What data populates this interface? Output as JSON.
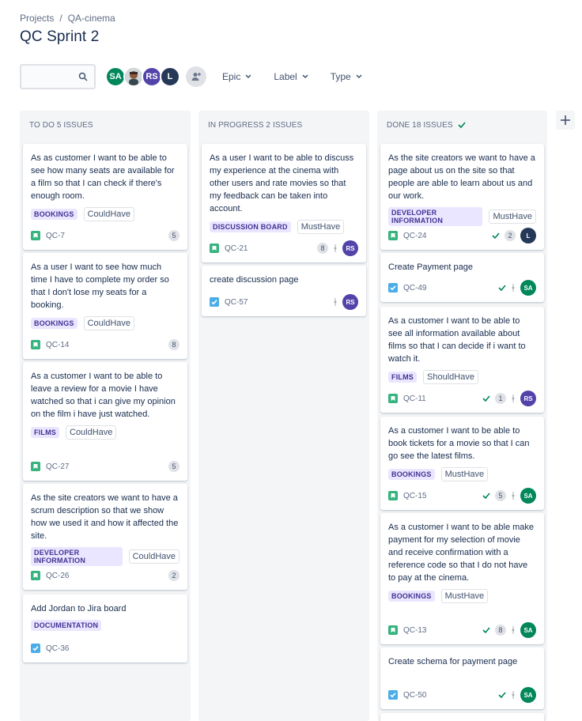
{
  "breadcrumb": {
    "projects": "Projects",
    "sep": "/",
    "project": "QA-cinema"
  },
  "title": "QC Sprint 2",
  "search": {
    "placeholder": ""
  },
  "avatars": [
    {
      "initials": "SA",
      "color": "#00875a"
    },
    {
      "initials": "",
      "color": "#a2744f"
    },
    {
      "initials": "RS",
      "color": "#5243aa"
    },
    {
      "initials": "L",
      "color": "#253858"
    }
  ],
  "filters": {
    "epic": "Epic",
    "label": "Label",
    "type": "Type"
  },
  "columns": [
    {
      "title": "TO DO 5 ISSUES"
    },
    {
      "title": "IN PROGRESS 2 ISSUES"
    },
    {
      "title": "DONE 18 ISSUES"
    }
  ],
  "cards": {
    "todo": [
      {
        "summary": "As as customer I want to be able to see how many seats are available for a film so that I can check if there's enough room.",
        "label": "BOOKINGS",
        "priority": "CouldHave",
        "key": "QC-7",
        "estimate": "5",
        "type": "story"
      },
      {
        "summary": "As a user I want to see how much time I have to complete my order so that I don't lose my seats for a booking.",
        "label": "BOOKINGS",
        "priority": "CouldHave",
        "key": "QC-14",
        "estimate": "8",
        "type": "story"
      },
      {
        "summary": "As a customer I want to be able to leave a review for a movie I have watched so that i can give my opinion on the film i have just watched.",
        "label": "FILMS",
        "priority": "CouldHave",
        "key": "QC-27",
        "estimate": "5",
        "type": "story"
      },
      {
        "summary": "As the site creators we want to have a scrum description so that we show how we used it and how it affected the site.",
        "label": "DEVELOPER INFORMATION",
        "priority": "CouldHave",
        "key": "QC-26",
        "estimate": "2",
        "type": "story"
      },
      {
        "summary": "Add Jordan to Jira board",
        "label": "DOCUMENTATION",
        "priority": "",
        "key": "QC-36",
        "estimate": "",
        "type": "task"
      }
    ],
    "inprogress": [
      {
        "summary": "As a user I want to be able to discuss my experience at the cinema with other users and rate movies so that my feedback can be taken into account.",
        "label": "DISCUSSION BOARD",
        "priority": "MustHave",
        "key": "QC-21",
        "estimate": "8",
        "assignee": "RS",
        "type": "story"
      },
      {
        "summary": "create discussion page",
        "label": "",
        "priority": "",
        "key": "QC-57",
        "estimate": "",
        "assignee": "RS",
        "type": "task"
      }
    ],
    "done": [
      {
        "summary": "As the site creators we want to have a page about us on the site so that people are able to learn about us and our work.",
        "label": "DEVELOPER INFORMATION",
        "priority": "MustHave",
        "key": "QC-24",
        "estimate": "2",
        "assignee": "L",
        "type": "story"
      },
      {
        "summary": "Create Payment page",
        "label": "",
        "priority": "",
        "key": "QC-49",
        "estimate": "",
        "assignee": "SA",
        "type": "task"
      },
      {
        "summary": "As a customer I want to be able to see all information available about films so that I can decide if i want to watch it.",
        "label": "FILMS",
        "priority": "ShouldHave",
        "key": "QC-11",
        "estimate": "1",
        "assignee": "RS",
        "type": "story"
      },
      {
        "summary": "As a customer I want to be able to book tickets for a movie so that I can go see the latest films.",
        "label": "BOOKINGS",
        "priority": "MustHave",
        "key": "QC-15",
        "estimate": "5",
        "assignee": "SA",
        "type": "story"
      },
      {
        "summary": "As a customer I want to be able make payment for my selection of movie and receive confirmation with a reference code so that I do not have to pay at the cinema.",
        "label": "BOOKINGS",
        "priority": "MustHave",
        "key": "QC-13",
        "estimate": "8",
        "assignee": "SA",
        "type": "story"
      },
      {
        "summary": "Create schema for payment page",
        "label": "",
        "priority": "",
        "key": "QC-50",
        "estimate": "",
        "assignee": "SA",
        "type": "task"
      }
    ]
  },
  "colors": {
    "story": "#36b37e",
    "task": "#4bade8",
    "lozenge_bg": "#eae6ff",
    "lozenge_fg": "#403294",
    "done_check": "#00875a"
  }
}
